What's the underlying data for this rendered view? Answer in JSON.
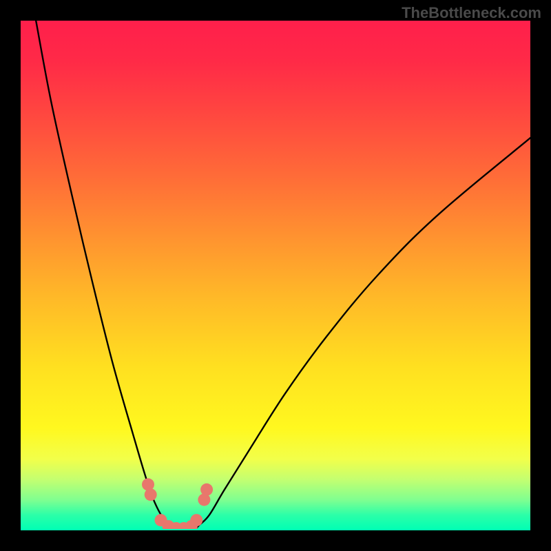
{
  "watermark": "TheBottleneck.com",
  "chart_data": {
    "type": "line",
    "title": "",
    "xlabel": "",
    "ylabel": "",
    "xlim": [
      0,
      100
    ],
    "ylim": [
      0,
      100
    ],
    "grid": false,
    "legend": false,
    "series": [
      {
        "name": "left-curve",
        "x": [
          3,
          6,
          10,
          14,
          18,
          22,
          25,
          27,
          29,
          30,
          31
        ],
        "values": [
          100,
          84,
          66,
          49,
          33,
          19,
          9,
          4,
          1,
          0,
          0
        ]
      },
      {
        "name": "right-curve",
        "x": [
          33,
          34,
          35,
          37,
          40,
          45,
          52,
          60,
          70,
          82,
          100
        ],
        "values": [
          0,
          0,
          1,
          3,
          8,
          16,
          27,
          38,
          50,
          62,
          77
        ]
      }
    ],
    "markers": [
      {
        "name": "m1",
        "x": 25.0,
        "y": 9.0
      },
      {
        "name": "m2",
        "x": 25.5,
        "y": 7.0
      },
      {
        "name": "m3",
        "x": 27.5,
        "y": 2.0
      },
      {
        "name": "m4",
        "x": 29.0,
        "y": 0.8
      },
      {
        "name": "m5",
        "x": 30.5,
        "y": 0.4
      },
      {
        "name": "m6",
        "x": 32.0,
        "y": 0.4
      },
      {
        "name": "m7",
        "x": 33.5,
        "y": 0.8
      },
      {
        "name": "m8",
        "x": 34.5,
        "y": 2.0
      },
      {
        "name": "m9",
        "x": 36.0,
        "y": 6.0
      },
      {
        "name": "m10",
        "x": 36.5,
        "y": 8.0
      }
    ],
    "marker_color": "#e8776c",
    "curve_color": "#000000"
  }
}
